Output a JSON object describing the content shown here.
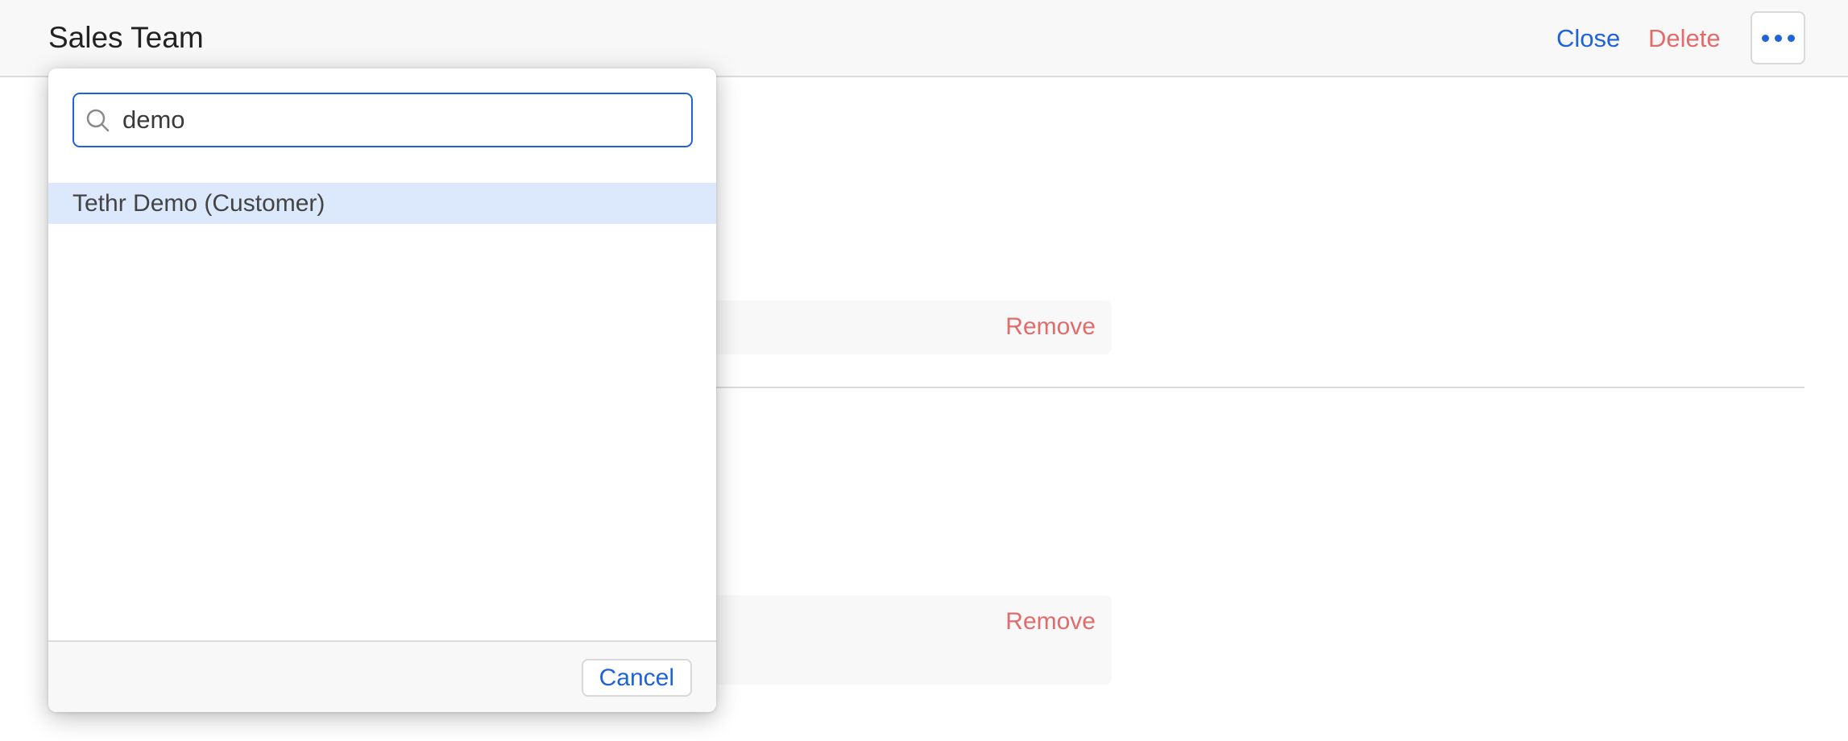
{
  "header": {
    "title": "Sales Team",
    "close_label": "Close",
    "delete_label": "Delete",
    "more_icon": "more-horizontal-icon"
  },
  "content": {
    "rows": [
      {
        "remove_label": "Remove"
      },
      {
        "remove_label": "Remove"
      }
    ]
  },
  "popover": {
    "search": {
      "value": "demo",
      "icon": "search-icon"
    },
    "results": [
      {
        "label": "Tethr Demo (Customer)",
        "highlighted": true
      }
    ],
    "cancel_label": "Cancel"
  },
  "colors": {
    "accent": "#1f63d9",
    "danger": "#e06c6c",
    "highlight": "#dce8fc"
  }
}
